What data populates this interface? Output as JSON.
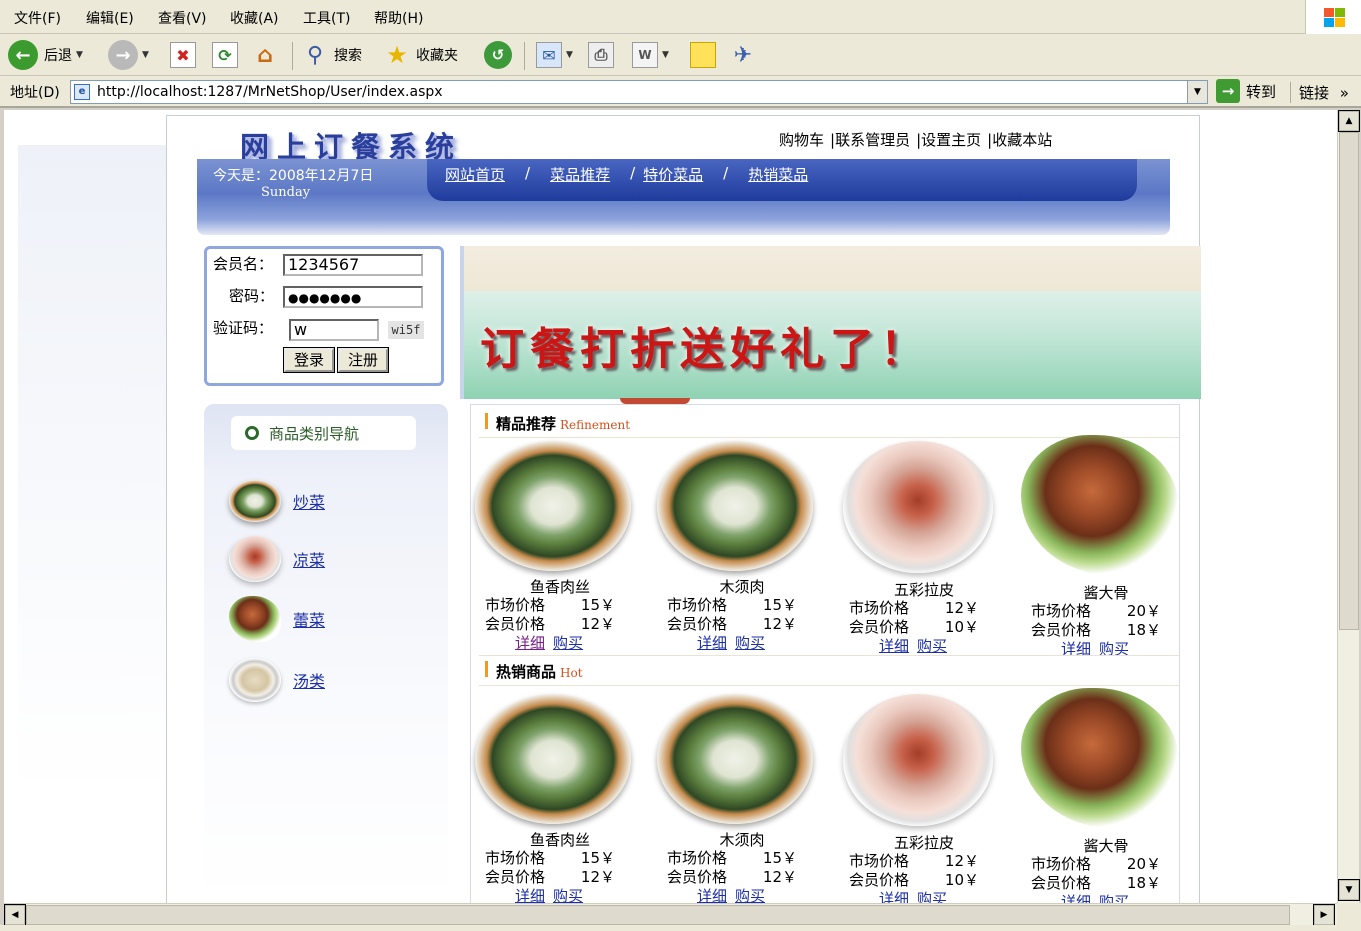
{
  "browser": {
    "menu": [
      "文件(F)",
      "编辑(E)",
      "查看(V)",
      "收藏(A)",
      "工具(T)",
      "帮助(H)"
    ],
    "toolbar": {
      "back": "后退",
      "search": "搜索",
      "favorites": "收藏夹"
    },
    "address_label": "地址(D)",
    "url": "http://localhost:1287/MrNetShop/User/index.aspx",
    "go_label": "转到",
    "links_label": "链接"
  },
  "site": {
    "logo_text": "网上订餐系统",
    "top_links": [
      "购物车",
      "|联系管理员",
      "|设置主页",
      "|收藏本站"
    ],
    "date_text": "今天是：2008年12月7日",
    "weekday": "Sunday",
    "nav": [
      "网站首页",
      "菜品推荐",
      "特价菜品",
      "热销菜品"
    ],
    "nav_sep": "/",
    "promo_text": "订餐打折送好礼了！"
  },
  "login": {
    "username_label": "会员名：",
    "username_value": "1234567",
    "password_label": "密码：",
    "password_value": "●●●●●●●",
    "captcha_label": "验证码：",
    "captcha_input": "w",
    "captcha_code": "wi5f",
    "login_button": "登录",
    "register_button": "注册"
  },
  "categories": {
    "title": "商品类别导航",
    "items": [
      "炒菜",
      "凉菜",
      "蕾菜",
      "汤类"
    ]
  },
  "sections": {
    "recommend": {
      "title": "精品推荐",
      "subtitle": "Refinement"
    },
    "hot": {
      "title": "热销商品",
      "subtitle": "Hot"
    }
  },
  "labels": {
    "market": "市场价格",
    "member": "会员价格",
    "detail": "详细",
    "buy": "购买"
  },
  "products": [
    {
      "name": "鱼香肉丝",
      "market": "15￥",
      "member": "12￥"
    },
    {
      "name": "木须肉",
      "market": "15￥",
      "member": "12￥"
    },
    {
      "name": "五彩拉皮",
      "market": "12￥",
      "member": "10￥"
    },
    {
      "name": "酱大骨",
      "market": "20￥",
      "member": "18￥"
    }
  ],
  "colors": {
    "link": "#1c2fa6",
    "banner": "#1f3c9c",
    "promo_text": "#cc1616",
    "accent": "#f29a1a"
  }
}
